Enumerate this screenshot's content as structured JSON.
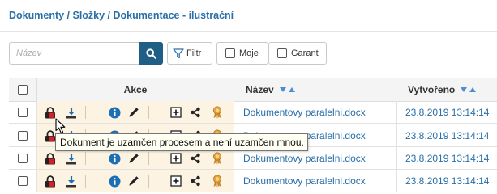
{
  "breadcrumb": {
    "text": "Dokumenty / Složky / Dokumentace - ilustrační"
  },
  "search": {
    "placeholder": "Název",
    "value": ""
  },
  "toolbar": {
    "filter_label": "Filtr",
    "moje_label": "Moje",
    "garant_label": "Garant"
  },
  "table": {
    "headers": {
      "akce": "Akce",
      "nazev": "Název",
      "vytvoreno": "Vytvořeno"
    },
    "rows": [
      {
        "name": "Dokumentovy paralelni.docx",
        "created": "23.8.2019 13:14:14"
      },
      {
        "name": "Dokumentovy paralelni.docx",
        "created": "23.8.2019 13:14:14"
      },
      {
        "name": "Dokumentovy paralelni.docx",
        "created": "23.8.2019 13:14:14"
      },
      {
        "name": "Dokumentovy paralelni.docx",
        "created": "23.8.2019 13:14:14"
      }
    ]
  },
  "tooltip": {
    "text": "Dokument je uzamčen procesem a není uzamčen mnou."
  },
  "icons": [
    "lock-icon",
    "download-icon",
    "info-icon",
    "edit-icon",
    "add-icon",
    "share-icon",
    "award-icon",
    "search-icon",
    "filter-icon",
    "sort-icon",
    "cursor-icon"
  ],
  "colors": {
    "link": "#2a6fa8",
    "search_button": "#1f5f86",
    "actions_background": "#fdf3e3",
    "lock_red": "#d3202a",
    "download_blue": "#1d6fb3",
    "info_blue": "#1d6fb3"
  }
}
